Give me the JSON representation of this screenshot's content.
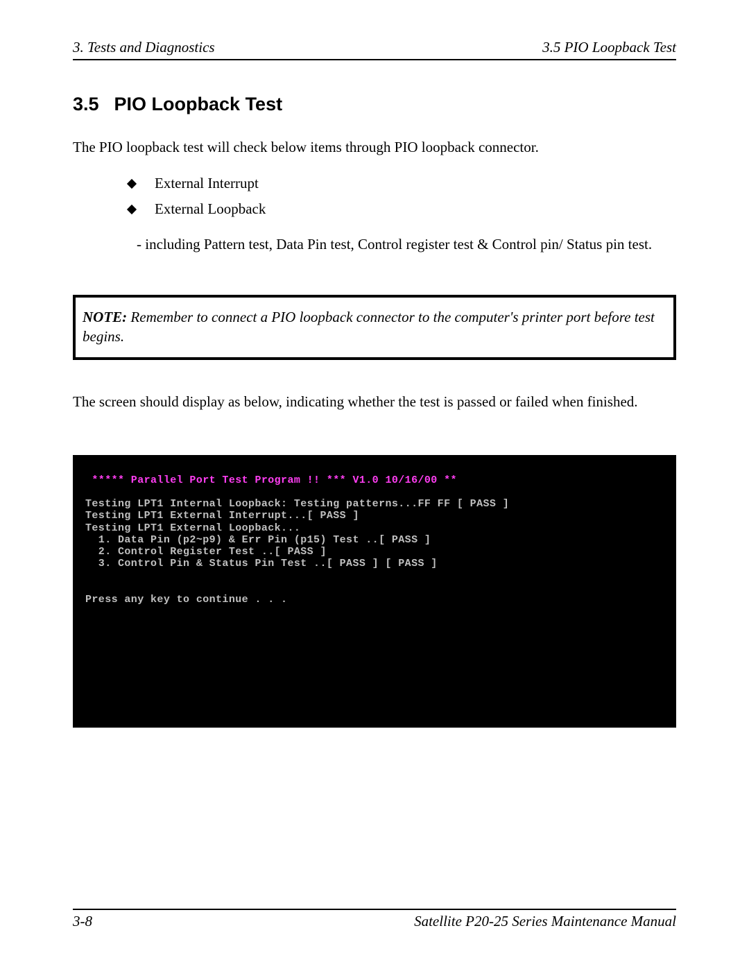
{
  "header": {
    "left": "3.  Tests and Diagnostics",
    "right": "3.5 PIO Loopback Test"
  },
  "section": {
    "number": "3.5",
    "title": "PIO Loopback Test"
  },
  "intro": "The PIO loopback test will check below items through PIO loopback connector.",
  "bullets": {
    "b1": "External Interrupt",
    "b2": "External Loopback"
  },
  "sub_note": "- including Pattern test, Data Pin test, Control register test & Control pin/ Status pin test.",
  "note": {
    "label": "NOTE:",
    "text": "  Remember to connect a PIO loopback connector to the computer's printer port before test begins."
  },
  "after_note": "The screen should display as below, indicating whether the test is passed or failed when finished.",
  "terminal": {
    "title": " ***** Parallel Port Test Program !! *** V1.0 10/16/00 **",
    "l1": "Testing LPT1 Internal Loopback: Testing patterns...FF FF [ PASS ]",
    "l2": "Testing LPT1 External Interrupt...[ PASS ]",
    "l3": "Testing LPT1 External Loopback...",
    "l4": "  1. Data Pin (p2~p9) & Err Pin (p15) Test ..[ PASS ]",
    "l5": "  2. Control Register Test ..[ PASS ]",
    "l6": "  3. Control Pin & Status Pin Test ..[ PASS ] [ PASS ]",
    "prompt": "Press any key to continue . . ."
  },
  "footer": {
    "left": "3-8",
    "right": "Satellite P20-25 Series Maintenance Manual"
  }
}
